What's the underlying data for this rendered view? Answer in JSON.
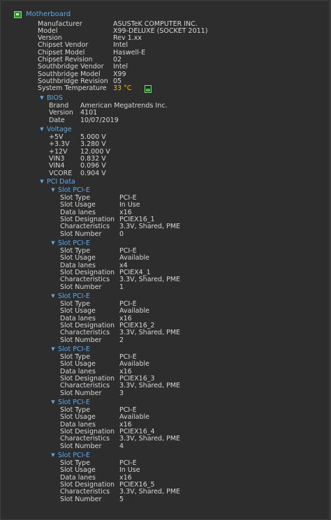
{
  "root": {
    "label": "Motherboard"
  },
  "mb": [
    {
      "label": "Manufacturer",
      "value": "ASUSTeK COMPUTER INC."
    },
    {
      "label": "Model",
      "value": "X99-DELUXE (SOCKET 2011)"
    },
    {
      "label": "Version",
      "value": "Rev 1.xx"
    },
    {
      "label": "Chipset Vendor",
      "value": "Intel"
    },
    {
      "label": "Chipset Model",
      "value": "Haswell-E"
    },
    {
      "label": "Chipset Revision",
      "value": "02"
    },
    {
      "label": "Southbridge Vendor",
      "value": "Intel"
    },
    {
      "label": "Southbridge Model",
      "value": "X99"
    },
    {
      "label": "Southbridge Revision",
      "value": "05"
    }
  ],
  "sys_temp": {
    "label": "System Temperature",
    "value": "33 °C",
    "icon": "thermometer-icon",
    "color": "#e8c000"
  },
  "bios": {
    "title": "BIOS",
    "rows": [
      {
        "label": "Brand",
        "value": "American Megatrends Inc."
      },
      {
        "label": "Version",
        "value": "4101"
      },
      {
        "label": "Date",
        "value": "10/07/2019"
      }
    ]
  },
  "voltage": {
    "title": "Voltage",
    "rows": [
      {
        "label": "+5V",
        "value": "5.000 V"
      },
      {
        "label": "+3.3V",
        "value": "3.280 V"
      },
      {
        "label": "+12V",
        "value": "12.000 V"
      },
      {
        "label": "VIN3",
        "value": "0.832 V"
      },
      {
        "label": "VIN4",
        "value": "0.096 V"
      },
      {
        "label": "VCORE",
        "value": "0.904 V"
      }
    ]
  },
  "pci": {
    "title": "PCI Data",
    "slots": [
      {
        "title": "Slot PCI-E",
        "rows": [
          {
            "label": "Slot Type",
            "value": "PCI-E"
          },
          {
            "label": "Slot Usage",
            "value": "In Use"
          },
          {
            "label": "Data lanes",
            "value": "x16"
          },
          {
            "label": "Slot Designation",
            "value": "PCIEX16_1"
          },
          {
            "label": "Characteristics",
            "value": "3.3V, Shared, PME"
          },
          {
            "label": "Slot Number",
            "value": "0"
          }
        ]
      },
      {
        "title": "Slot PCI-E",
        "rows": [
          {
            "label": "Slot Type",
            "value": "PCI-E"
          },
          {
            "label": "Slot Usage",
            "value": "Available"
          },
          {
            "label": "Data lanes",
            "value": "x4"
          },
          {
            "label": "Slot Designation",
            "value": "PCIEX4_1"
          },
          {
            "label": "Characteristics",
            "value": "3.3V, Shared, PME"
          },
          {
            "label": "Slot Number",
            "value": "1"
          }
        ]
      },
      {
        "title": "Slot PCI-E",
        "rows": [
          {
            "label": "Slot Type",
            "value": "PCI-E"
          },
          {
            "label": "Slot Usage",
            "value": "Available"
          },
          {
            "label": "Data lanes",
            "value": "x16"
          },
          {
            "label": "Slot Designation",
            "value": "PCIEX16_2"
          },
          {
            "label": "Characteristics",
            "value": "3.3V, Shared, PME"
          },
          {
            "label": "Slot Number",
            "value": "2"
          }
        ]
      },
      {
        "title": "Slot PCI-E",
        "rows": [
          {
            "label": "Slot Type",
            "value": "PCI-E"
          },
          {
            "label": "Slot Usage",
            "value": "Available"
          },
          {
            "label": "Data lanes",
            "value": "x16"
          },
          {
            "label": "Slot Designation",
            "value": "PCIEX16_3"
          },
          {
            "label": "Characteristics",
            "value": "3.3V, Shared, PME"
          },
          {
            "label": "Slot Number",
            "value": "3"
          }
        ]
      },
      {
        "title": "Slot PCI-E",
        "rows": [
          {
            "label": "Slot Type",
            "value": "PCI-E"
          },
          {
            "label": "Slot Usage",
            "value": "Available"
          },
          {
            "label": "Data lanes",
            "value": "x16"
          },
          {
            "label": "Slot Designation",
            "value": "PCIEX16_4"
          },
          {
            "label": "Characteristics",
            "value": "3.3V, Shared, PME"
          },
          {
            "label": "Slot Number",
            "value": "4"
          }
        ]
      },
      {
        "title": "Slot PCI-E",
        "rows": [
          {
            "label": "Slot Type",
            "value": "PCI-E"
          },
          {
            "label": "Slot Usage",
            "value": "In Use"
          },
          {
            "label": "Data lanes",
            "value": "x16"
          },
          {
            "label": "Slot Designation",
            "value": "PCIEX16_5"
          },
          {
            "label": "Characteristics",
            "value": "3.3V, Shared, PME"
          },
          {
            "label": "Slot Number",
            "value": "5"
          }
        ]
      }
    ]
  }
}
